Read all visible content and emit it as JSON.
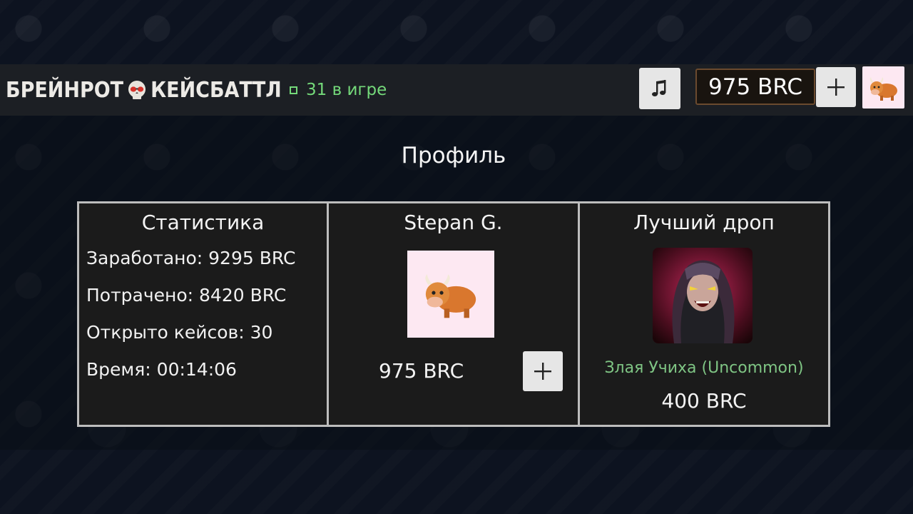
{
  "header": {
    "brand_left": "БРЕЙНРОТ",
    "brand_right": "КЕЙСБАТТЛ",
    "online_text": "31 в игре",
    "balance": "975 BRC",
    "plus_label": "+"
  },
  "profile": {
    "title": "Профиль",
    "stats": {
      "heading": "Статистика",
      "earned": "Заработано: 9295 BRC",
      "spent": "Потрачено: 8420 BRC",
      "cases_opened": "Открыто кейсов: 30",
      "time": "Время: 00:14:06"
    },
    "user": {
      "name": "Stepan G.",
      "balance": "975 BRC",
      "plus_label": "+"
    },
    "best_drop": {
      "heading": "Лучший дроп",
      "item_name": "Злая Учиха (Uncommon)",
      "price": "400 BRC",
      "rarity_color": "#7fc584"
    }
  },
  "icons": {
    "music": "music-note-icon",
    "avatar": "yak-avatar-icon",
    "brand": "skull-icon"
  }
}
